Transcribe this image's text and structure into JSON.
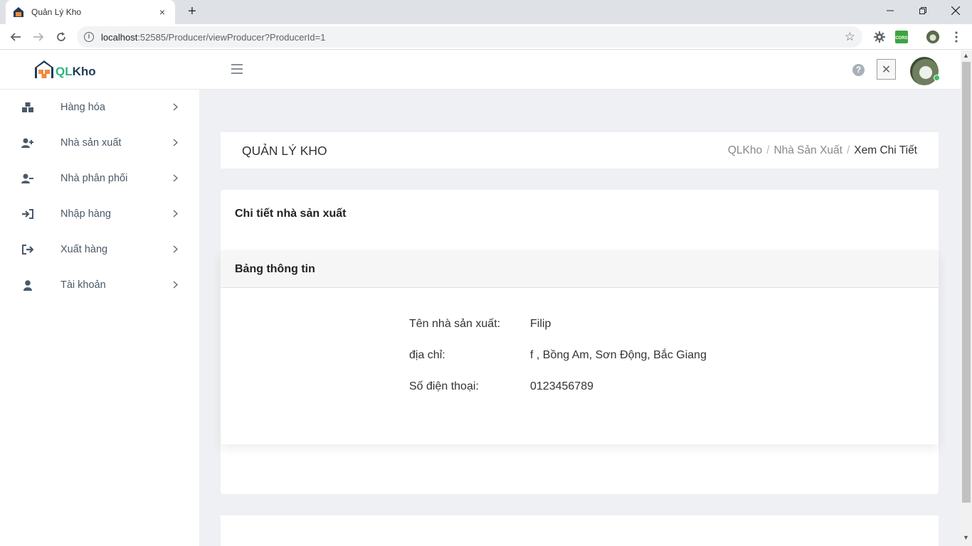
{
  "browser": {
    "tab_title": "Quản Lý Kho",
    "tab_close": "×",
    "new_tab": "+",
    "url_host": "localhost",
    "url_rest": ":52585/Producer/viewProducer?ProducerId=1",
    "ext_cors_label": "CORS"
  },
  "header": {
    "logo_ql": "QL",
    "logo_kho": "Kho",
    "help": "?",
    "close": "✕"
  },
  "sidebar": {
    "items": [
      {
        "label": "Hàng hóa",
        "icon": "boxes-icon"
      },
      {
        "label": "Nhà sản xuất",
        "icon": "user-plus-icon"
      },
      {
        "label": "Nhà phân phối",
        "icon": "user-minus-icon"
      },
      {
        "label": "Nhập hàng",
        "icon": "sign-in-icon"
      },
      {
        "label": "Xuất hàng",
        "icon": "sign-out-icon"
      },
      {
        "label": "Tài khoản",
        "icon": "user-icon"
      }
    ]
  },
  "titlebar": {
    "title": "QUẢN LÝ KHO",
    "breadcrumb": [
      "QLKho",
      "Nhà Sản Xuất",
      "Xem Chi Tiết"
    ],
    "separator": "/"
  },
  "card": {
    "title": "Chi tiết nhà sản xuất",
    "panel_title": "Bảng thông tin",
    "rows": [
      {
        "label": "Tên nhà sản xuất:",
        "value": "Filip"
      },
      {
        "label": "địa chỉ:",
        "value": "f , Bồng Am, Sơn Động, Bắc Giang"
      },
      {
        "label": "Số điện thoại:",
        "value": "0123456789"
      }
    ]
  },
  "colors": {
    "accent_green": "#2db37e",
    "logo_navy": "#1f3b57",
    "main_bg": "#eef0f3",
    "sidebar_text": "#4a5968"
  }
}
